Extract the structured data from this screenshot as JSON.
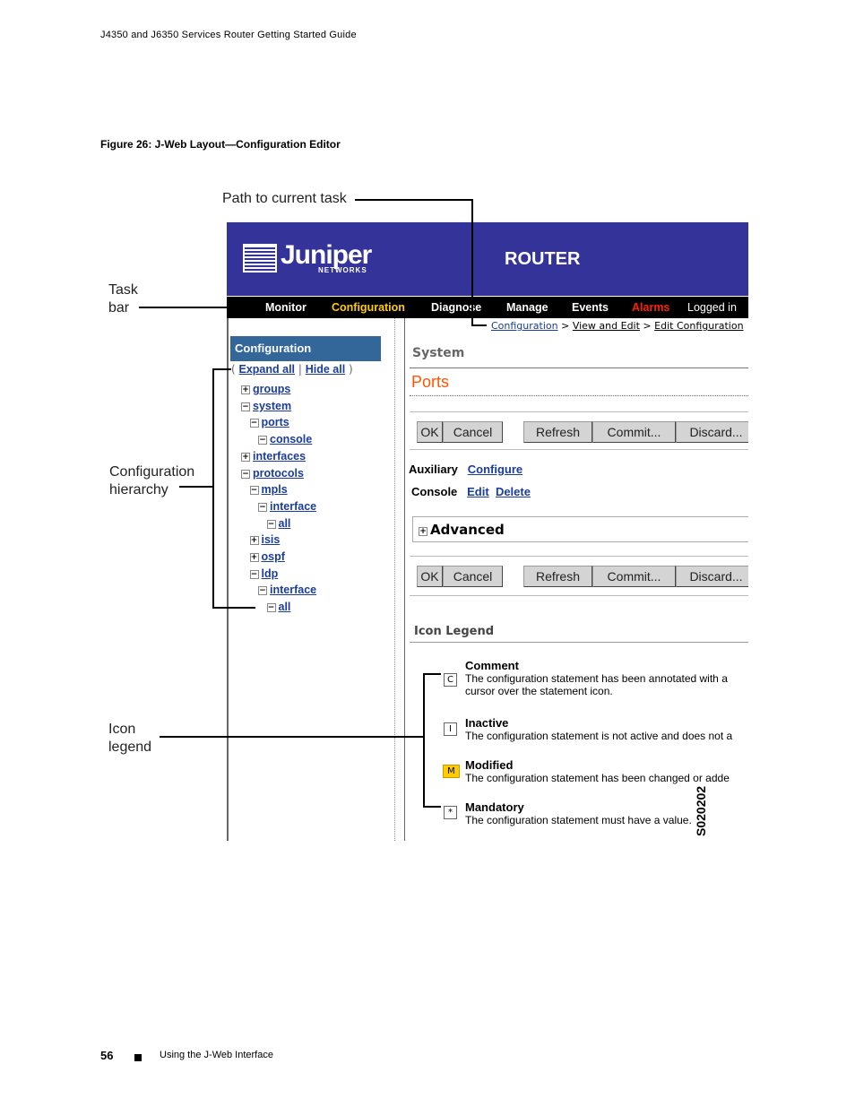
{
  "header": "J4350 and J6350 Services Router Getting Started Guide",
  "figure_caption": "Figure 26:  J-Web Layout—Configuration Editor",
  "callouts": {
    "path": "Path to current task",
    "task_bar": [
      "Task",
      "bar"
    ],
    "config_hierarchy": [
      "Configuration",
      "hierarchy"
    ],
    "icon_legend": [
      "Icon",
      "legend"
    ]
  },
  "screen": {
    "logo": "Juniper",
    "logo_sub": "NETWORKS",
    "device": "ROUTER",
    "taskbar": [
      "Monitor",
      "Configuration",
      "Diagnose",
      "Manage",
      "Events",
      "Alarms",
      "Logged in"
    ],
    "colors": {
      "banner": "#333399",
      "active_task": "#ffcc00",
      "alarms": "#ff2200",
      "title": "#ff5500",
      "link": "#1a3c9c",
      "tree_header": "#336699",
      "modified": "#ffcc00"
    },
    "breadcrumb": [
      "Configuration",
      "View and Edit",
      "Edit Configuration"
    ],
    "tree_header": "Configuration",
    "expand_all": "Expand all",
    "hide_all": "Hide all",
    "tree": [
      {
        "label": "groups",
        "sign": "+",
        "depth": 0
      },
      {
        "label": "system",
        "sign": "−",
        "depth": 0
      },
      {
        "label": "ports",
        "sign": "−",
        "depth": 1
      },
      {
        "label": "console",
        "sign": "−",
        "depth": 2
      },
      {
        "label": "interfaces",
        "sign": "+",
        "depth": 0
      },
      {
        "label": "protocols",
        "sign": "−",
        "depth": 0
      },
      {
        "label": "mpls",
        "sign": "−",
        "depth": 1
      },
      {
        "label": "interface",
        "sign": "−",
        "depth": 2
      },
      {
        "label": "all",
        "sign": "−",
        "depth": 3
      },
      {
        "label": "isis",
        "sign": "+",
        "depth": 1
      },
      {
        "label": "ospf",
        "sign": "+",
        "depth": 1
      },
      {
        "label": "ldp",
        "sign": "−",
        "depth": 1
      },
      {
        "label": "interface",
        "sign": "−",
        "depth": 2
      },
      {
        "label": "all",
        "sign": "−",
        "depth": 3
      }
    ],
    "section": "System",
    "page_title": "Ports",
    "buttons": [
      "OK",
      "Cancel",
      "Refresh",
      "Commit...",
      "Discard..."
    ],
    "auxiliary": {
      "label": "Auxiliary",
      "configure": "Configure"
    },
    "console": {
      "label": "Console",
      "edit": "Edit",
      "delete": "Delete"
    },
    "advanced": "Advanced",
    "legend_title": "Icon Legend",
    "legend": [
      {
        "icon": "C",
        "title": "Comment",
        "text": [
          "The configuration statement has been annotated with a",
          "cursor over the statement icon."
        ]
      },
      {
        "icon": "I",
        "title": "Inactive",
        "text": [
          "The configuration statement is not active and does not a"
        ]
      },
      {
        "icon": "M",
        "title": "Modified",
        "text": [
          "The configuration statement has been changed or adde"
        ]
      },
      {
        "icon": "*",
        "title": "Mandatory",
        "text": [
          "The configuration statement must have a value."
        ]
      }
    ],
    "figure_id": "S020202"
  },
  "footer": {
    "page": "56",
    "section": "Using the J-Web Interface"
  }
}
